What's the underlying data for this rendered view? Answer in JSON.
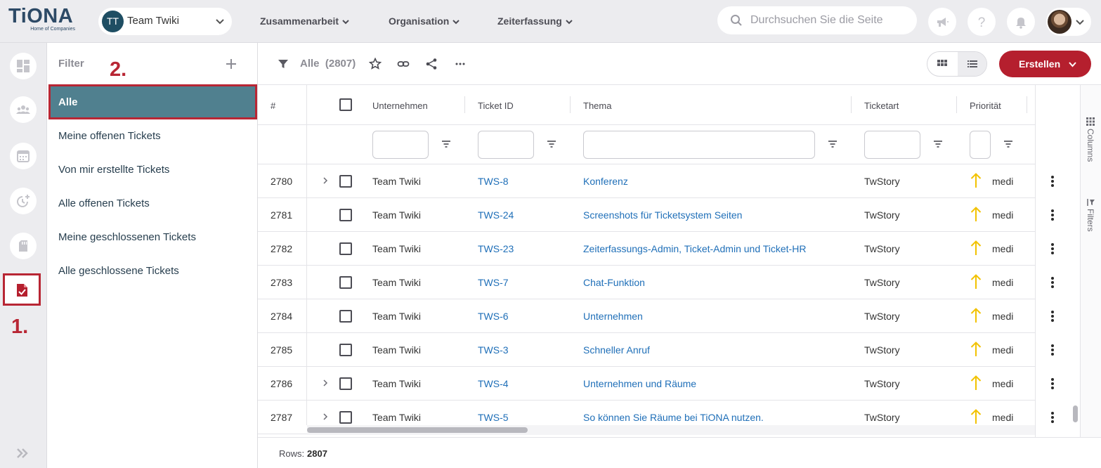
{
  "app": {
    "logo_text": "TiONA",
    "logo_tagline": "Home of Companies"
  },
  "team_select": {
    "initials": "TT",
    "name": "Team Twiki"
  },
  "nav": [
    {
      "label": "Zusammenarbeit"
    },
    {
      "label": "Organisation"
    },
    {
      "label": "Zeiterfassung"
    }
  ],
  "search": {
    "placeholder": "Durchsuchen Sie die Seite",
    "value": ""
  },
  "annotations": {
    "step1": "1.",
    "step2": "2."
  },
  "filter_panel": {
    "title": "Filter",
    "items": [
      {
        "label": "Alle",
        "active": true
      },
      {
        "label": "Meine offenen Tickets"
      },
      {
        "label": "Von mir erstellte Tickets"
      },
      {
        "label": "Alle offenen Tickets"
      },
      {
        "label": "Meine geschlossenen Tickets"
      },
      {
        "label": "Alle geschlossene Tickets"
      }
    ]
  },
  "toolbar": {
    "label": "Alle",
    "count": "(2807)",
    "create_label": "Erstellen"
  },
  "grid": {
    "columns": [
      "#",
      "Unternehmen",
      "Ticket ID",
      "Thema",
      "Ticketart",
      "Priorität"
    ],
    "rows": [
      {
        "num": "2780",
        "company": "Team Twiki",
        "ticket_id": "TWS-8",
        "topic": "Konferenz",
        "type": "TwStory",
        "priority": "medi",
        "expandable": true
      },
      {
        "num": "2781",
        "company": "Team Twiki",
        "ticket_id": "TWS-24",
        "topic": "Screenshots für Ticketsystem Seiten",
        "type": "TwStory",
        "priority": "medi",
        "expandable": false
      },
      {
        "num": "2782",
        "company": "Team Twiki",
        "ticket_id": "TWS-23",
        "topic": "Zeiterfassungs-Admin, Ticket-Admin und Ticket-HR",
        "type": "TwStory",
        "priority": "medi",
        "expandable": false
      },
      {
        "num": "2783",
        "company": "Team Twiki",
        "ticket_id": "TWS-7",
        "topic": "Chat-Funktion",
        "type": "TwStory",
        "priority": "medi",
        "expandable": false
      },
      {
        "num": "2784",
        "company": "Team Twiki",
        "ticket_id": "TWS-6",
        "topic": "Unternehmen",
        "type": "TwStory",
        "priority": "medi",
        "expandable": false
      },
      {
        "num": "2785",
        "company": "Team Twiki",
        "ticket_id": "TWS-3",
        "topic": "Schneller Anruf",
        "type": "TwStory",
        "priority": "medi",
        "expandable": false
      },
      {
        "num": "2786",
        "company": "Team Twiki",
        "ticket_id": "TWS-4",
        "topic": "Unternehmen und Räume",
        "type": "TwStory",
        "priority": "medi",
        "expandable": true
      },
      {
        "num": "2787",
        "company": "Team Twiki",
        "ticket_id": "TWS-5",
        "topic": "So können Sie Räume bei TiONA nutzen.",
        "type": "TwStory",
        "priority": "medi",
        "expandable": true
      }
    ]
  },
  "side_tools": {
    "columns": "Columns",
    "filters": "Filters"
  },
  "footer": {
    "rows_label": "Rows:",
    "rows_count": "2807"
  },
  "colors": {
    "brand_red": "#b51f2e",
    "brand_navy": "#2d4a66",
    "active_filter_bg": "#50808f",
    "link": "#1f6fb8",
    "priority_arrow": "#f2c200"
  }
}
